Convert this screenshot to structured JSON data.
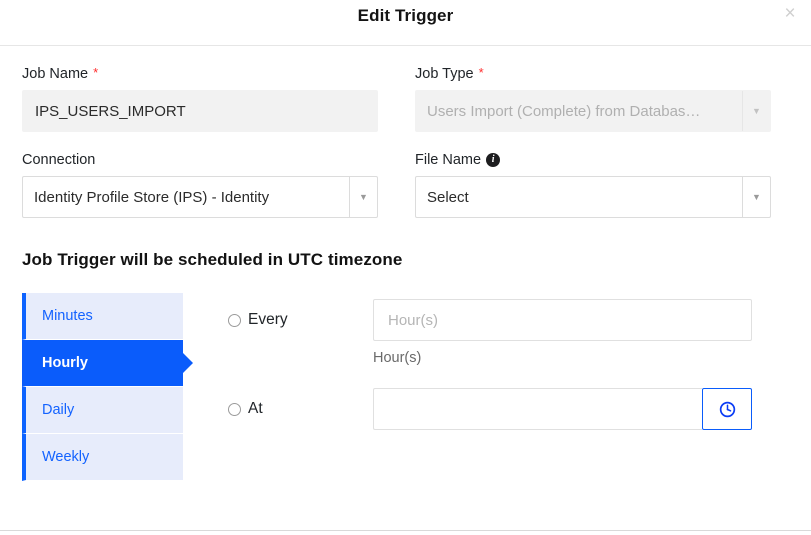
{
  "modal": {
    "title": "Edit Trigger",
    "close_label": "×"
  },
  "form": {
    "job_name": {
      "label": "Job Name",
      "required_marker": "*",
      "value": "IPS_USERS_IMPORT"
    },
    "job_type": {
      "label": "Job Type",
      "required_marker": "*",
      "value": "Users Import (Complete) from Databas…",
      "arrow": "▼"
    },
    "connection": {
      "label": "Connection",
      "value": "Identity Profile Store (IPS) - Identity",
      "arrow": "▼"
    },
    "file_name": {
      "label": "File Name",
      "info_icon": "i",
      "value": "Select",
      "arrow": "▼"
    }
  },
  "schedule": {
    "heading": "Job Trigger will be scheduled in UTC timezone",
    "tabs": [
      {
        "label": "Minutes",
        "active": false
      },
      {
        "label": "Hourly",
        "active": true
      },
      {
        "label": "Daily",
        "active": false
      },
      {
        "label": "Weekly",
        "active": false
      }
    ],
    "every": {
      "radio_label": "Every",
      "input_value": "",
      "input_placeholder": "Hour(s)",
      "helper_text": "Hour(s)"
    },
    "at": {
      "radio_label": "At",
      "input_value": "",
      "input_placeholder": ""
    }
  },
  "colors": {
    "accent_blue": "#0a5cfb",
    "tab_inactive_bg": "#e7ecfb",
    "required_red": "#ff2d2d",
    "disabled_bg": "#f2f2f2"
  }
}
